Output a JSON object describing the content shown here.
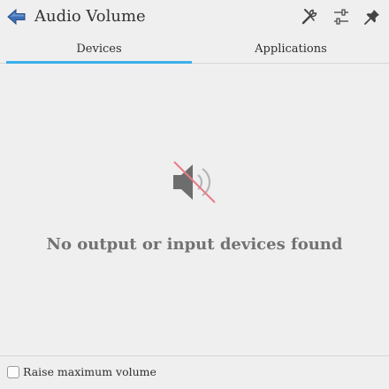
{
  "header": {
    "title": "Audio Volume",
    "back_icon": "arrow-left-icon",
    "configure_icon": "configure-wrench-icon",
    "mixer_icon": "audio-mixer-sliders-icon",
    "pin_icon": "pin-icon"
  },
  "tabs": [
    {
      "label": "Devices",
      "selected": true
    },
    {
      "label": "Applications",
      "selected": false
    }
  ],
  "empty_state": {
    "icon": "speaker-muted-icon",
    "message": "No output or input devices found"
  },
  "footer": {
    "checkbox_label": "Raise maximum volume",
    "checked": false
  },
  "colors": {
    "accent": "#3daee9",
    "background": "#efefef",
    "muted_slash": "#e77d86",
    "back_arrow": "#3c6fb5"
  }
}
